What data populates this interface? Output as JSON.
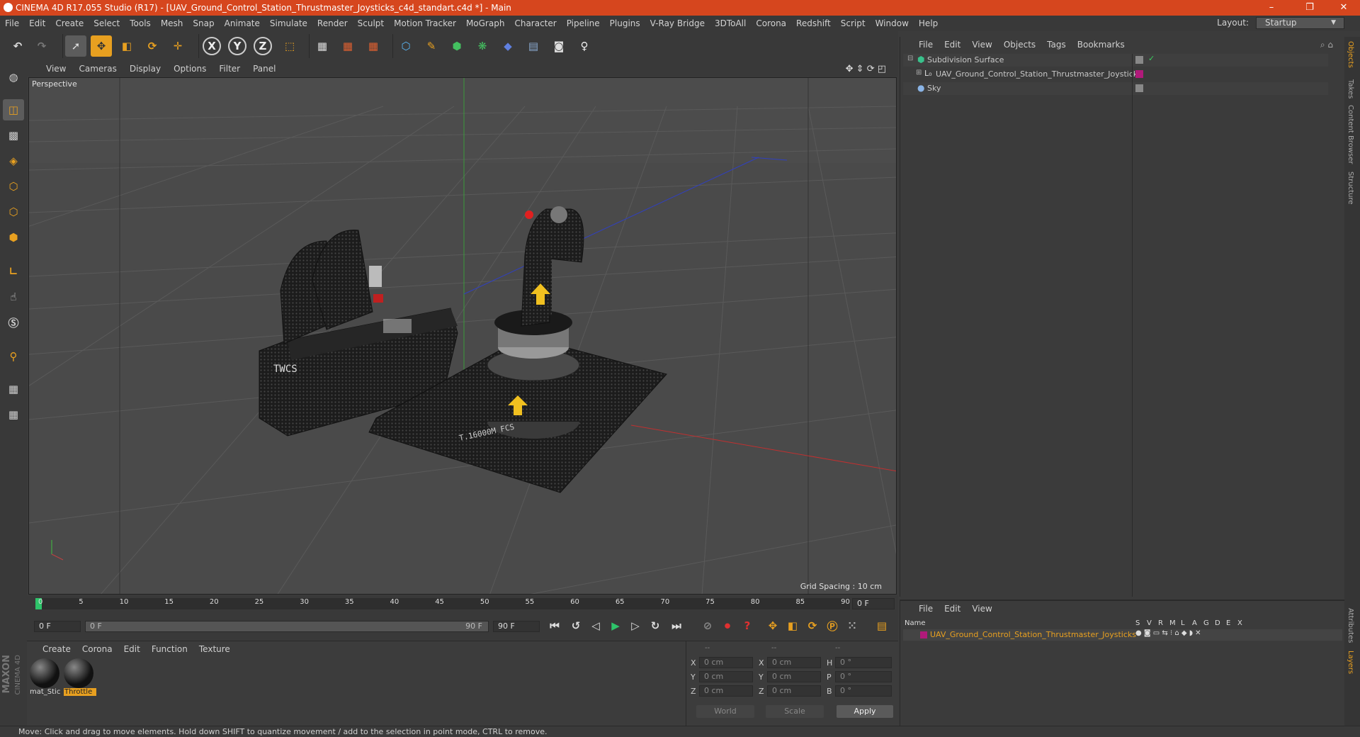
{
  "titlebar": {
    "title": "CINEMA 4D R17.055 Studio (R17) - [UAV_Ground_Control_Station_Thrustmaster_Joysticks_c4d_standart.c4d *] - Main",
    "minimize": "–",
    "maximize": "❐",
    "close": "✕"
  },
  "menubar": {
    "items": [
      "File",
      "Edit",
      "Create",
      "Select",
      "Tools",
      "Mesh",
      "Snap",
      "Animate",
      "Simulate",
      "Render",
      "Sculpt",
      "Motion Tracker",
      "MoGraph",
      "Character",
      "Pipeline",
      "Plugins",
      "V-Ray Bridge",
      "3DToAll",
      "Corona",
      "Redshift",
      "Script",
      "Window",
      "Help"
    ],
    "layout_label": "Layout:",
    "layout_value": "Startup"
  },
  "toolbar": {
    "x_label": "X",
    "y_label": "Y",
    "z_label": "Z"
  },
  "viewport": {
    "menu": [
      "View",
      "Cameras",
      "Display",
      "Options",
      "Filter",
      "Panel"
    ],
    "camera_label": "Perspective",
    "grid_spacing": "Grid Spacing : 10 cm",
    "nav_icons": "✥ ⇕ ⟳ ◰"
  },
  "timeline": {
    "ticks": [
      "0",
      "5",
      "10",
      "15",
      "20",
      "25",
      "30",
      "35",
      "40",
      "45",
      "50",
      "55",
      "60",
      "65",
      "70",
      "75",
      "80",
      "85",
      "90"
    ],
    "current_frame": "0 F"
  },
  "transport": {
    "start": "0 F",
    "range_start": "0 F",
    "range_end": "90 F",
    "end": "90 F"
  },
  "material_manager": {
    "menu": [
      "Create",
      "Corona",
      "Edit",
      "Function",
      "Texture"
    ],
    "materials": [
      {
        "name": "mat_Stic"
      },
      {
        "name": "Throttle"
      }
    ]
  },
  "coordinates": {
    "header": [
      "--",
      "--",
      "--"
    ],
    "rows": [
      {
        "a": "X",
        "av": "0 cm",
        "b": "X",
        "bv": "0 cm",
        "c": "H",
        "cv": "0 °"
      },
      {
        "a": "Y",
        "av": "0 cm",
        "b": "Y",
        "bv": "0 cm",
        "c": "P",
        "cv": "0 °"
      },
      {
        "a": "Z",
        "av": "0 cm",
        "b": "Z",
        "bv": "0 cm",
        "c": "B",
        "cv": "0 °"
      }
    ],
    "space": "World",
    "mode": "Scale",
    "apply": "Apply"
  },
  "object_manager": {
    "menu": [
      "File",
      "Edit",
      "View",
      "Objects",
      "Tags",
      "Bookmarks"
    ],
    "objects": [
      {
        "name": "Subdivision Surface",
        "color": "#39c18c"
      },
      {
        "name": "UAV_Ground_Control_Station_Thrustmaster_Joysticks",
        "color": "#c8c8c8"
      },
      {
        "name": "Sky",
        "color": "#8ab4e6"
      }
    ]
  },
  "layer_manager": {
    "menu": [
      "File",
      "Edit",
      "View"
    ],
    "columns": [
      "Name",
      "S",
      "V",
      "R",
      "M",
      "L",
      "A",
      "G",
      "D",
      "E",
      "X"
    ],
    "layer_name": "UAV_Ground_Control_Station_Thrustmaster_Joysticks"
  },
  "right_tabs": [
    "Objects",
    "Takes",
    "Content Browser",
    "Structure",
    "Attributes",
    "Layers"
  ],
  "branding": {
    "maxon": "MAXON",
    "c4d": "CINEMA 4D"
  },
  "statusbar": {
    "text": "Move: Click and drag to move elements. Hold down SHIFT to quantize movement / add to the selection in point mode, CTRL to remove."
  },
  "colors": {
    "accent": "#d6461e",
    "selection": "#e8a020",
    "layer": "#b01a7a"
  }
}
